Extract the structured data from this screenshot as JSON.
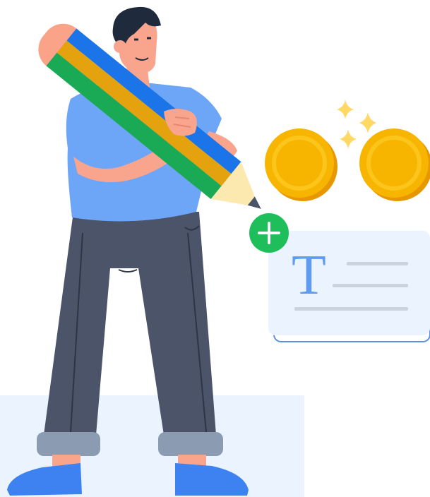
{
  "illustration": {
    "card": {
      "glyph": "T"
    },
    "icons": {
      "add": "plus-icon",
      "coin": "coin-icon",
      "sparkle": "sparkle-icon"
    },
    "colors": {
      "floor": "#EAF3FE",
      "card_bg": "#EBF4FE",
      "card_border": "#5A8FE6",
      "glyph": "#5F9BF2",
      "card_line": "#C9D3DE",
      "coin": "#F7B500",
      "coin_rim": "#FBC51B",
      "coin_shadow": "#E79700",
      "sparkle": "#FFD866",
      "plus_bg": "#1EBE5A",
      "shirt": "#6EA6F7",
      "pants": "#4B5468",
      "pants_cuff": "#8B9BB2",
      "shoe": "#3E82F2",
      "skin": "#F9A58E",
      "hair": "#1F2B3D",
      "pencil_blue": "#1B74E8",
      "pencil_orange": "#E3A20E",
      "pencil_green": "#1AAA55",
      "pencil_eraser": "#FBA389",
      "pencil_wood": "#FCE9B0"
    }
  }
}
